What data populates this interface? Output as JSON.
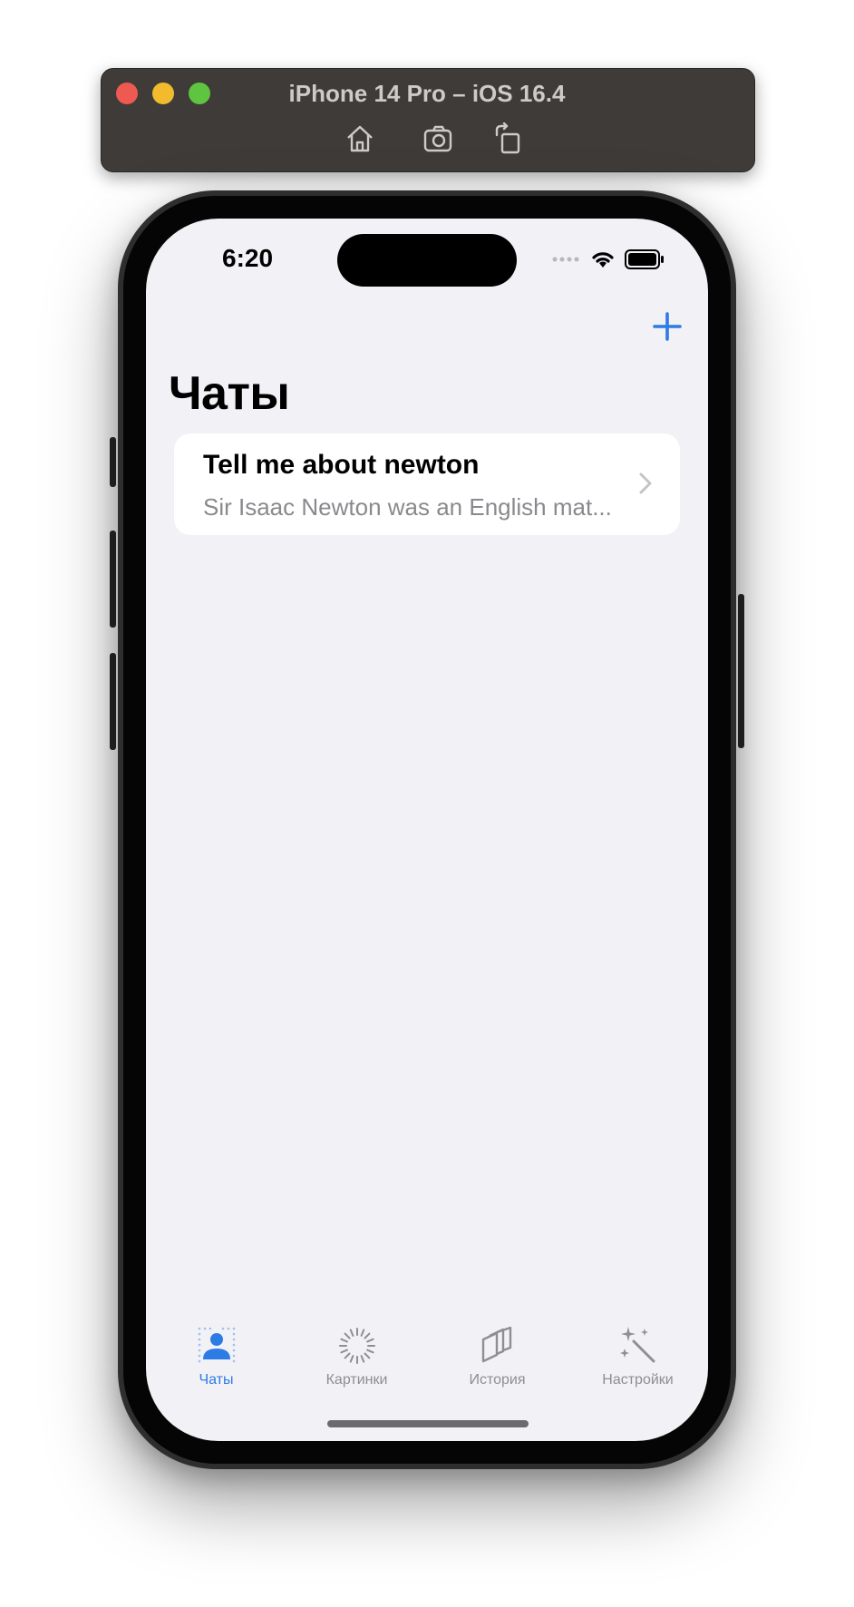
{
  "simulator": {
    "title": "iPhone 14 Pro – iOS 16.4",
    "toolbar": [
      "home-icon",
      "screenshot-icon",
      "rotate-icon"
    ]
  },
  "status_bar": {
    "time": "6:20"
  },
  "nav": {
    "title": "Чаты"
  },
  "chats": [
    {
      "title": "Tell me about newton",
      "preview": "Sir Isaac Newton was an English mat..."
    }
  ],
  "tabs": [
    {
      "label": "Чаты",
      "icon": "chat-person-icon",
      "active": true
    },
    {
      "label": "Картинки",
      "icon": "loading-spinner-icon",
      "active": false
    },
    {
      "label": "История",
      "icon": "stack-icon",
      "active": false
    },
    {
      "label": "Настройки",
      "icon": "magic-wand-icon",
      "active": false
    }
  ],
  "colors": {
    "accent": "#2d7be5",
    "background": "#f2f1f6",
    "inactive_tab": "#8e8e93"
  }
}
